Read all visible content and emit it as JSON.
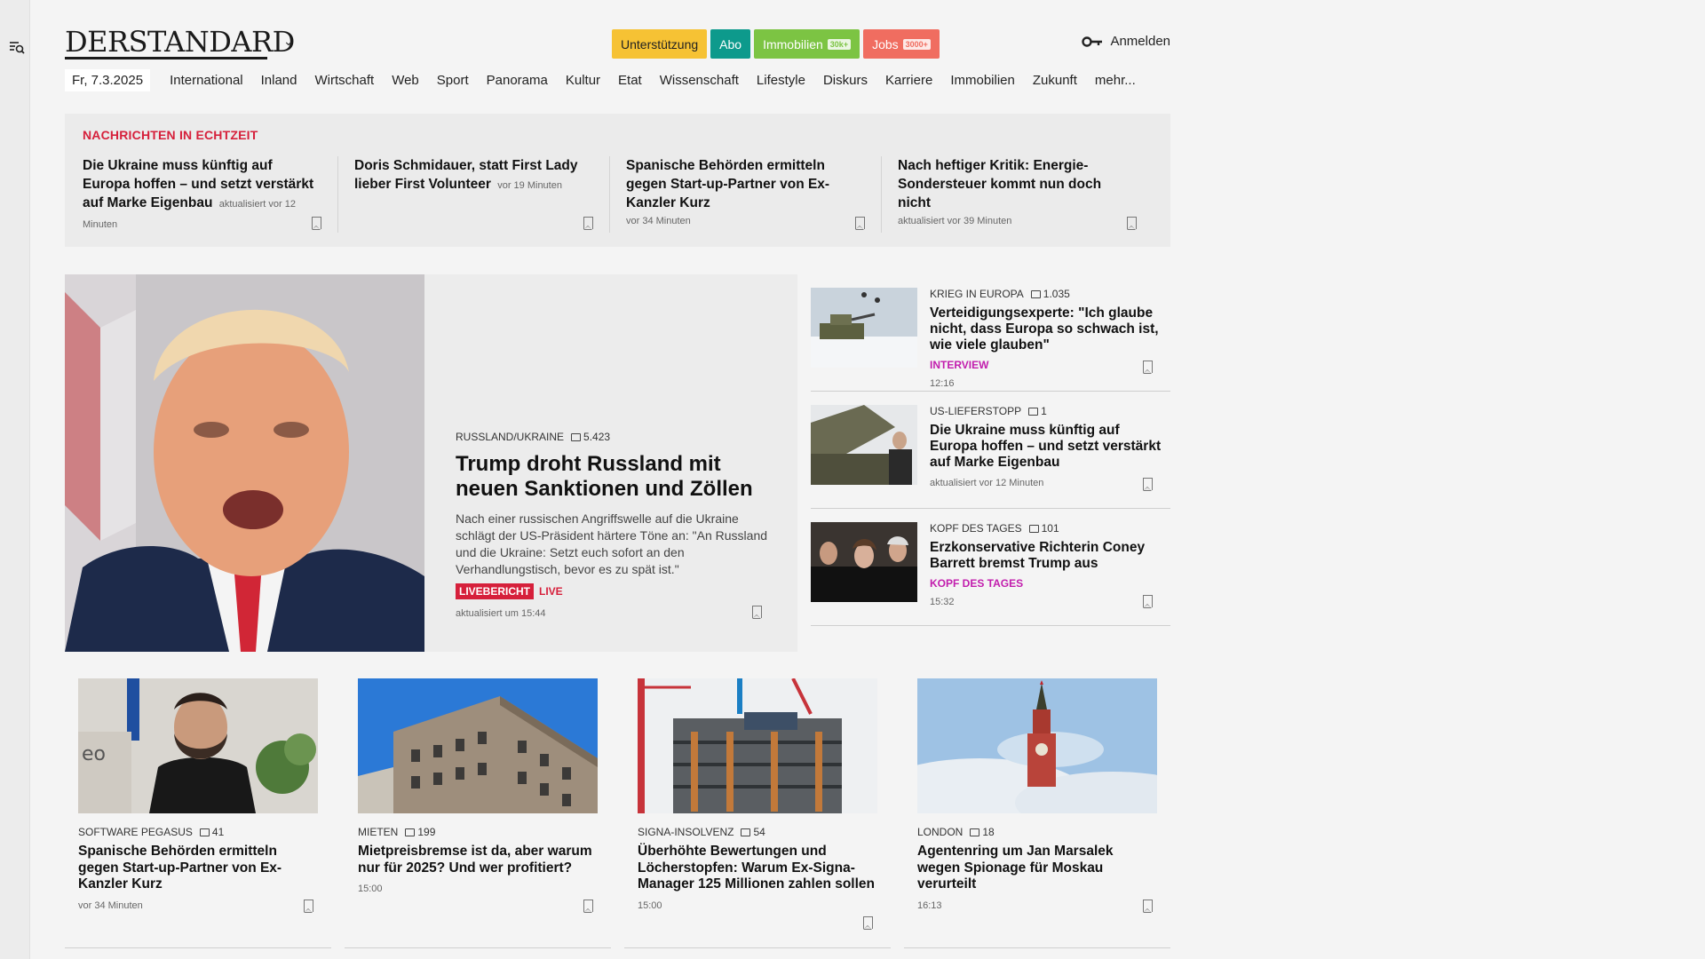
{
  "site": {
    "logo": "DERSTANDARD",
    "header_pills": [
      {
        "label": "Unterstützung",
        "tag": "",
        "bg": "#f6c234",
        "fg": "#222"
      },
      {
        "label": "Abo",
        "tag": "",
        "bg": "#0d9a8c",
        "fg": "#ffffff"
      },
      {
        "label": "Immobilien",
        "tag": "30k+",
        "bg": "#7cc443",
        "fg": "#ffffff"
      },
      {
        "label": "Jobs",
        "tag": "3000+",
        "bg": "#f06d60",
        "fg": "#ffffff"
      }
    ],
    "login_label": "Anmelden"
  },
  "nav": {
    "date": "Fr, 7.3.2025",
    "items": [
      "International",
      "Inland",
      "Wirtschaft",
      "Web",
      "Sport",
      "Panorama",
      "Kultur",
      "Etat",
      "Wissenschaft",
      "Lifestyle",
      "Diskurs",
      "Karriere",
      "Immobilien",
      "Zukunft",
      "mehr..."
    ]
  },
  "ticker": {
    "title": "NACHRICHTEN IN ECHTZEIT",
    "items": [
      {
        "headline": "Die Ukraine muss künftig auf Europa hoffen – und setzt verstärkt auf Marke Eigenbau",
        "time": "aktualisiert vor 12 Minuten"
      },
      {
        "headline": "Doris Schmidauer, statt First Lady lieber First Volunteer",
        "time": "vor 19 Minuten"
      },
      {
        "headline": "Spanische Behörden ermitteln gegen Start-up-Partner von Ex-Kanzler Kurz",
        "time": "vor 34 Minuten"
      },
      {
        "headline": "Nach heftiger Kritik: Energie-Sondersteuer kommt nun doch nicht",
        "time": "aktualisiert vor 39 Minuten"
      }
    ]
  },
  "hero": {
    "kicker": "RUSSLAND/UKRAINE",
    "comments": "5.423",
    "title": "Trump droht Russland mit neuen Sanktionen und Zöllen",
    "teaser": "Nach einer russischen Angriffswelle auf die Ukraine schlägt der US-Präsident härtere Töne an: \"An Russland und die Ukraine: Setzt euch sofort an den Verhandlungstisch, bevor es zu spät ist.\"",
    "badge": "LIVEBERICHT",
    "live": "LIVE",
    "time": "aktualisiert um 15:44"
  },
  "side": [
    {
      "kicker": "KRIEG IN EUROPA",
      "comments": "1.035",
      "title": "Verteidigungsexperte: \"Ich glaube nicht, dass Europa so schwach ist, wie viele glauben\"",
      "flag": "INTERVIEW",
      "time": "12:16"
    },
    {
      "kicker": "US-LIEFERSTOPP",
      "comments": "1",
      "title": "Die Ukraine muss künftig auf Europa hoffen – und setzt verstärkt auf Marke Eigenbau",
      "flag": "",
      "time": "aktualisiert vor 12 Minuten"
    },
    {
      "kicker": "KOPF DES TAGES",
      "comments": "101",
      "title": "Erzkonservative Richterin Coney Barrett bremst Trump aus",
      "flag": "KOPF DES TAGES",
      "time": "15:32"
    }
  ],
  "cards": [
    {
      "kicker": "SOFTWARE PEGASUS",
      "comments": "41",
      "title": "Spanische Behörden ermitteln gegen Start-up-Partner von Ex-Kanzler Kurz",
      "time": "vor 34 Minuten"
    },
    {
      "kicker": "MIETEN",
      "comments": "199",
      "title": "Mietpreisbremse ist da, aber warum nur für 2025? Und wer profitiert?",
      "time": "15:00"
    },
    {
      "kicker": "SIGNA-INSOLVENZ",
      "comments": "54",
      "title": "Überhöhte Bewertungen und Löcherstopfen: Warum Ex-Signa-Manager 125 Millionen zahlen sollen",
      "time": "15:00"
    },
    {
      "kicker": "LONDON",
      "comments": "18",
      "title": "Agentenring um Jan Marsalek wegen Spionage für Moskau verurteilt",
      "time": "16:13"
    }
  ],
  "colors": {
    "accent_red": "#d6203b",
    "flag_magenta": "#c21dad"
  }
}
